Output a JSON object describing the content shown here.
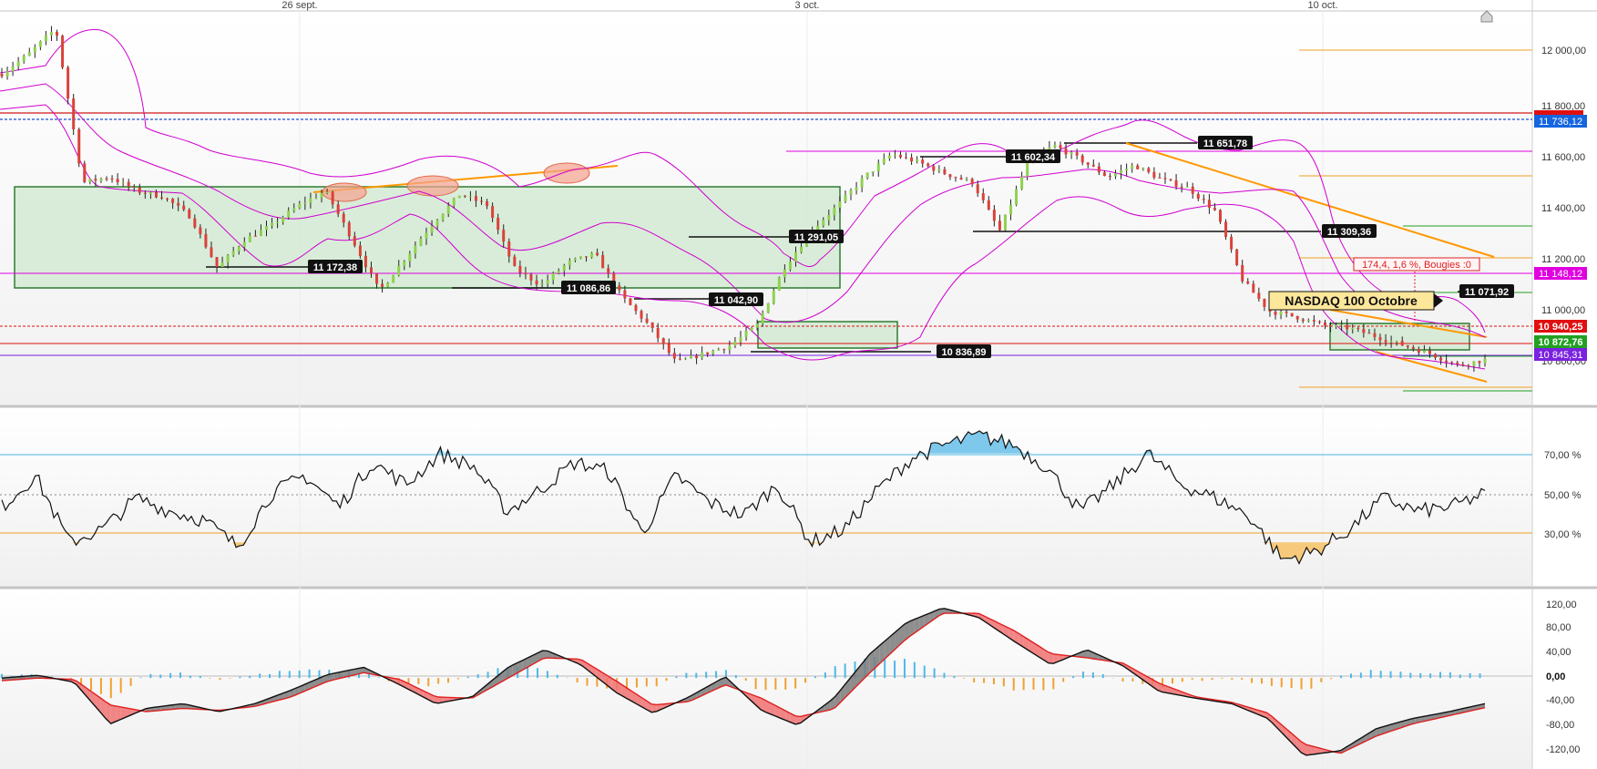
{
  "x_axis": {
    "dates": [
      "26 sept.",
      "3 oct.",
      "10 oct."
    ]
  },
  "price_panel": {
    "title": "NASDAQ 100 Octobre",
    "y_ticks": [
      "12 000,00",
      "11 800,00",
      "11 600,00",
      "11 400,00",
      "11 200,00",
      "11 000,00",
      "10 800,00"
    ],
    "tags": [
      {
        "text": "11 736,12",
        "color": "#1565e0"
      },
      {
        "text": "11 148,12",
        "color": "#e000e0"
      },
      {
        "text": "10 940,25",
        "color": "#e01010"
      },
      {
        "text": "10 872,76",
        "color": "#22a022"
      },
      {
        "text": "10 845,31",
        "color": "#7a22e0"
      }
    ],
    "level_labels": [
      "11 651,78",
      "11 602,34",
      "11 309,36",
      "11 291,05",
      "11 172,38",
      "11 086,86",
      "11 071,92",
      "11 042,90",
      "10 836,89"
    ],
    "measure_label": "174,4, 1,6 %, Bougies :0"
  },
  "rsi_panel": {
    "y_ticks": [
      "70,00 %",
      "50,00 %",
      "30,00 %"
    ]
  },
  "macd_panel": {
    "y_ticks": [
      "120,00",
      "80,00",
      "40,00",
      "0,00",
      "-40,00",
      "-80,00",
      "-120,00"
    ]
  },
  "colors": {
    "bull": "#8fd14f",
    "bear": "#d9423a",
    "bollinger": "#d000d0",
    "zone_fill": "#cfe8cf",
    "zone_stroke": "#2e7d32",
    "trendline": "#ff9800",
    "rsi_over": "#7ec8ec",
    "rsi_under": "#f7c97a",
    "hist_pos": "#4fb8e8",
    "hist_neg": "#f0a030",
    "macd_signal": "#e02020"
  },
  "chart_data": [
    {
      "type": "line",
      "title": "NASDAQ 100 Octobre",
      "x": [
        "26 sept.",
        "3 oct.",
        "10 oct."
      ],
      "ylim": [
        10720,
        12100
      ],
      "series": [
        {
          "name": "",
          "values": [
            11880,
            11950,
            12040,
            11500,
            11520,
            11470,
            11450,
            11380,
            11200,
            11300,
            11350,
            11420,
            11470,
            11300,
            11120,
            11240,
            11360,
            11460,
            11420,
            11200,
            11140,
            11220,
            11250,
            11100,
            11000,
            10870,
            10900,
            10930,
            11000,
            11200,
            11330,
            11420,
            11520,
            11600,
            11570,
            11530,
            11500,
            11330,
            11560,
            11630,
            11580,
            11520,
            11560,
            11510,
            11480,
            11400,
            11160,
            11050,
            11030,
            11000,
            10990,
            10960,
            10930,
            10900,
            10860,
            10880
          ]
        }
      ]
    },
    {
      "type": "line",
      "x": [
        "26 sept.",
        "3 oct.",
        "10 oct."
      ],
      "ylim": [
        10,
        90
      ],
      "series": [
        {
          "name": "",
          "values": [
            46,
            60,
            30,
            36,
            50,
            44,
            40,
            28,
            52,
            60,
            46,
            66,
            56,
            70,
            64,
            44,
            54,
            66,
            62,
            34,
            60,
            48,
            42,
            56,
            30,
            36,
            54,
            68,
            74,
            78,
            74,
            64,
            44,
            56,
            70,
            56,
            50,
            42,
            22,
            26,
            36,
            50,
            44,
            46,
            52
          ]
        }
      ]
    },
    {
      "type": "line",
      "x": [
        "26 sept.",
        "3 oct.",
        "10 oct."
      ],
      "ylim": [
        -135,
        130
      ],
      "series": [
        {
          "name": "",
          "values": [
            0,
            4,
            -6,
            -68,
            -45,
            -38,
            -50,
            -38,
            -18,
            5,
            16,
            -10,
            -38,
            -28,
            16,
            42,
            20,
            -22,
            -52,
            -28,
            2,
            -48,
            -70,
            -30,
            36,
            82,
            104,
            90,
            54,
            20,
            42,
            18,
            -20,
            -30,
            -38,
            -60,
            -115,
            -108,
            -75,
            -60,
            -50,
            -38
          ]
        },
        {
          "name": "",
          "values": [
            -4,
            0,
            -2,
            -40,
            -50,
            -45,
            -48,
            -42,
            -28,
            -5,
            8,
            -2,
            -28,
            -30,
            0,
            30,
            28,
            -5,
            -40,
            -35,
            -10,
            -30,
            -58,
            -46,
            8,
            58,
            96,
            96,
            70,
            36,
            30,
            22,
            -8,
            -28,
            -36,
            -52,
            -98,
            -112,
            -86,
            -68,
            -56,
            -44
          ]
        }
      ]
    }
  ]
}
